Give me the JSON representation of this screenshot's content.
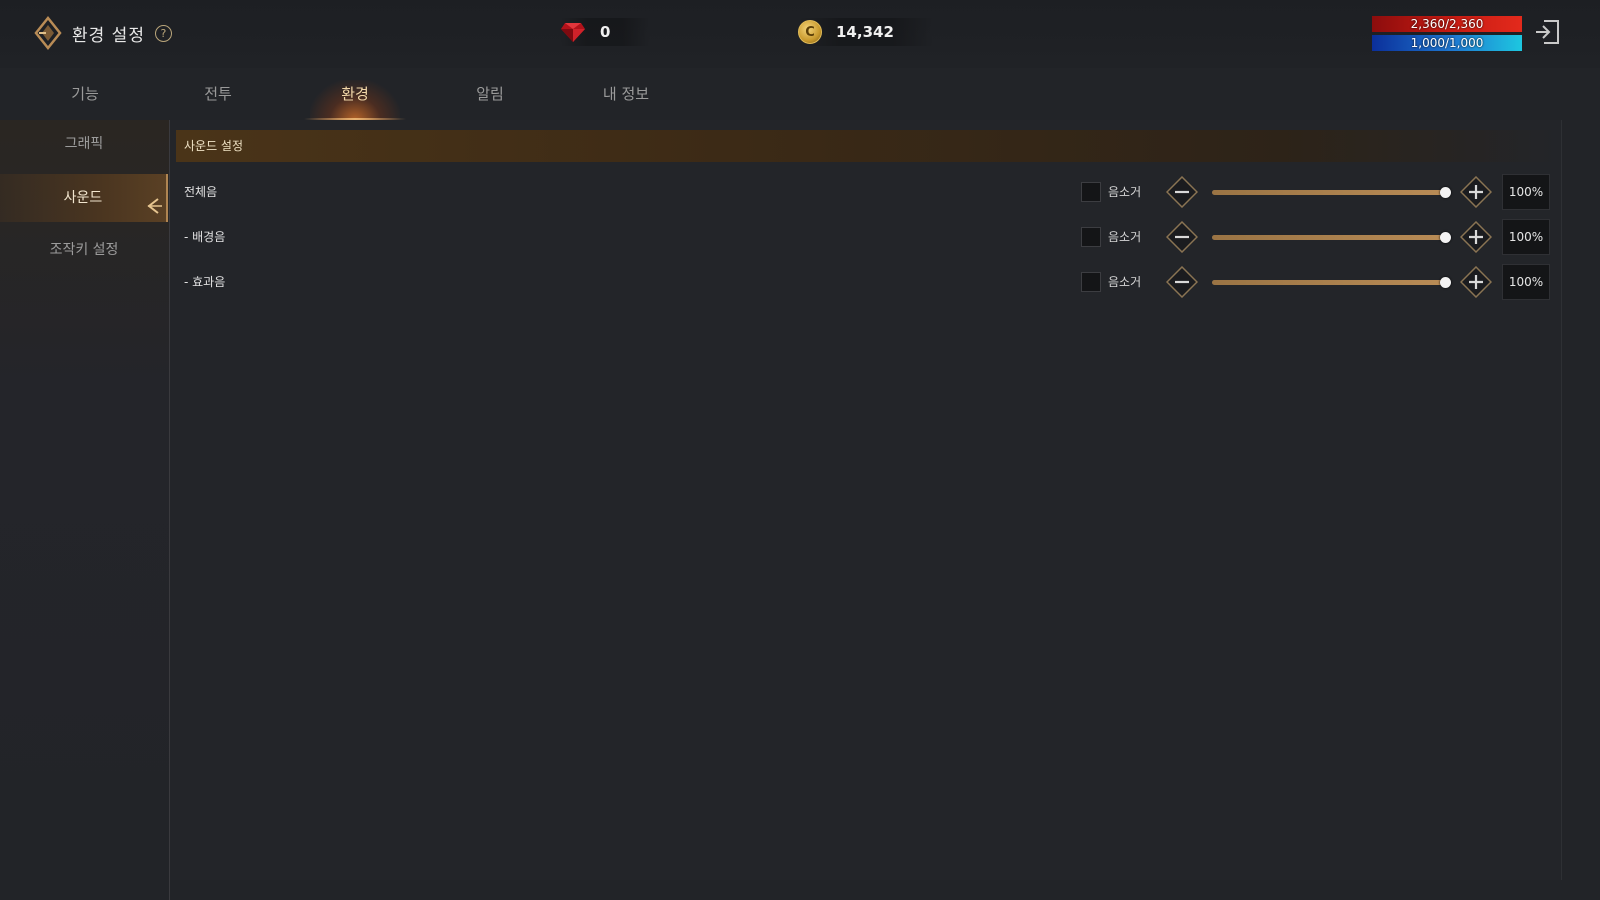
{
  "header": {
    "title": "환경 설정",
    "help_symbol": "?",
    "back_icon": "diamond-back-icon",
    "exit_icon": "exit-door-icon"
  },
  "currencies": {
    "gem": {
      "icon": "red-gem-icon",
      "value": "0"
    },
    "gold": {
      "icon": "gold-coin-icon",
      "symbol": "C",
      "value": "14,342"
    }
  },
  "status_bars": {
    "hp": {
      "text": "2,360/2,360",
      "fill": 1.0,
      "color": "#c51a12"
    },
    "mp": {
      "text": "1,000/1,000",
      "fill": 1.0,
      "color": "#1f7ad1"
    }
  },
  "tabs": [
    {
      "label": "기능",
      "active": false
    },
    {
      "label": "전투",
      "active": false
    },
    {
      "label": "환경",
      "active": true
    },
    {
      "label": "알림",
      "active": false
    },
    {
      "label": "내 정보",
      "active": false
    }
  ],
  "sidebar": {
    "items": [
      {
        "label": "그래픽",
        "active": false
      },
      {
        "label": "사운드",
        "active": true
      },
      {
        "label": "조작키 설정",
        "active": false
      }
    ]
  },
  "sound": {
    "section_title": "사운드 설정",
    "rows": [
      {
        "label": "전체음",
        "mute_label": "음소거",
        "muted": false,
        "value": 100,
        "value_text": "100%"
      },
      {
        "label": "- 배경음",
        "mute_label": "음소거",
        "muted": false,
        "value": 100,
        "value_text": "100%"
      },
      {
        "label": "- 효과음",
        "mute_label": "음소거",
        "muted": false,
        "value": 100,
        "value_text": "100%"
      }
    ]
  },
  "colors": {
    "accent": "#b98c56",
    "panel_bg": "#232529",
    "section_header": "#4a3418"
  }
}
